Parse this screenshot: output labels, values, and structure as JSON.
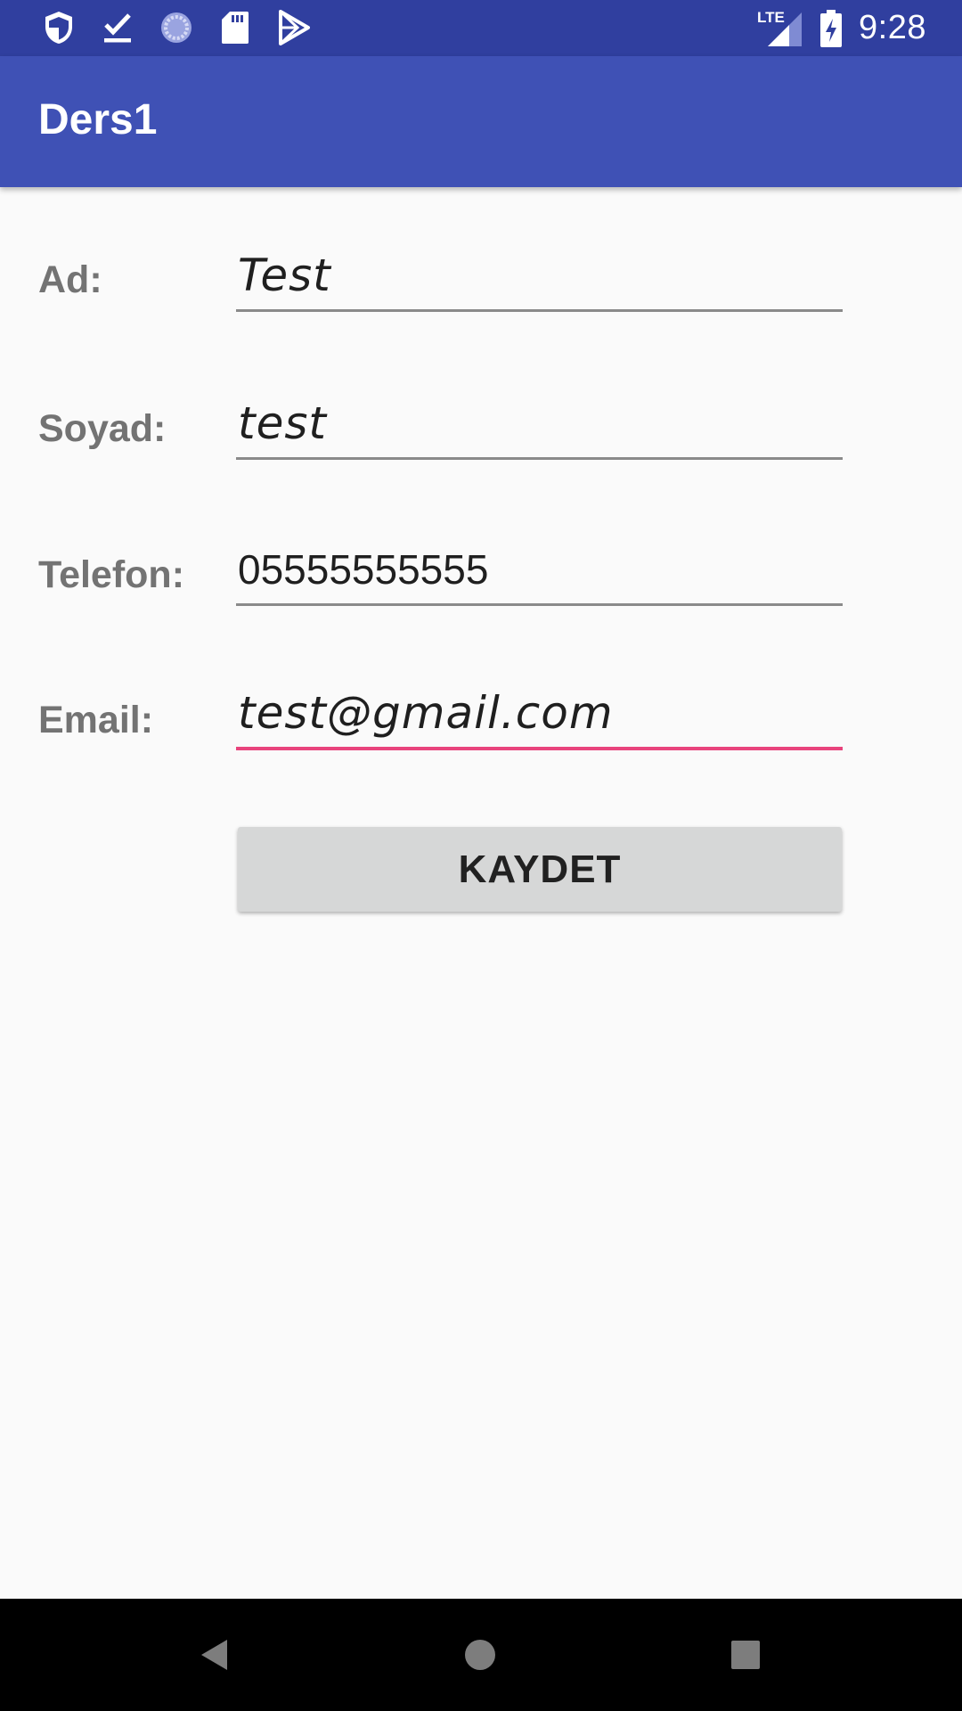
{
  "status_bar": {
    "time": "9:28",
    "network": "LTE",
    "left_icons": [
      "shield-icon",
      "download-done-icon",
      "sync-spinner-icon",
      "sd-card-icon",
      "play-store-icon"
    ],
    "right_icons": [
      "lte-signal-icon",
      "battery-charging-icon"
    ]
  },
  "app_bar": {
    "title": "Ders1",
    "color": "#3F51B5",
    "status_color": "#303F9F"
  },
  "form": {
    "fields": [
      {
        "label": "Ad:",
        "value": "Test"
      },
      {
        "label": "Soyad:",
        "value": "test"
      },
      {
        "label": "Telefon:",
        "value": "05555555555"
      },
      {
        "label": "Email:",
        "value": "test@gmail.com"
      }
    ],
    "focused_field": "Email:",
    "accent_color": "#E8437C"
  },
  "save_button": {
    "label": "KAYDET"
  },
  "nav_bar": {
    "buttons": [
      "back-icon",
      "home-icon",
      "recents-icon"
    ]
  }
}
